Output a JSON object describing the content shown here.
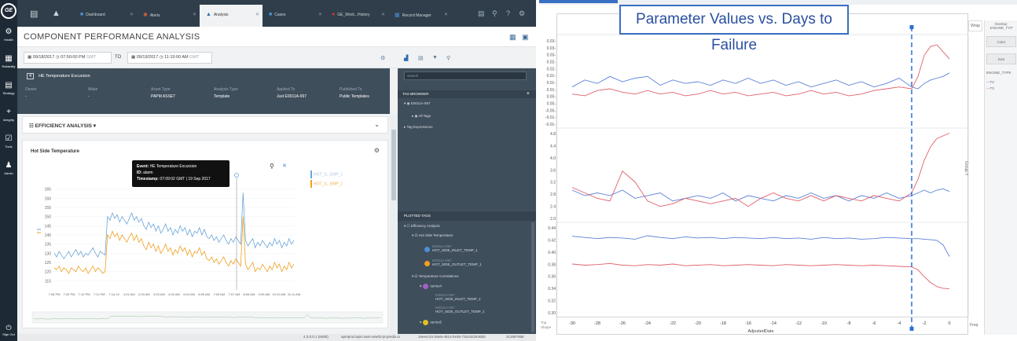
{
  "left_nav": {
    "logo": "GE",
    "items": [
      {
        "icon": "gear-icon",
        "glyph": "⚙",
        "label": "Health"
      },
      {
        "icon": "grid-icon",
        "glyph": "▦",
        "label": "Reliability"
      },
      {
        "icon": "calculator-icon",
        "glyph": "▤",
        "label": "Strategy"
      },
      {
        "icon": "plus-icon",
        "glyph": "+",
        "label": "Integrity"
      },
      {
        "icon": "check-icon",
        "glyph": "☑",
        "label": "Tools"
      },
      {
        "icon": "user-icon",
        "glyph": "♟",
        "label": "Admin"
      }
    ],
    "signout": "Sign Out"
  },
  "tabs": [
    {
      "label": "Dashboard",
      "icon": "dashboard-icon",
      "color": "#4a90d9"
    },
    {
      "label": "Alerts",
      "icon": "alert-icon",
      "color": "#e06040"
    },
    {
      "label": "Analysis",
      "icon": "analysis-icon",
      "color": "#2b6cb0"
    },
    {
      "label": "Cases",
      "icon": "cases-icon",
      "color": "#4a90d9"
    },
    {
      "label": "GE_Work...History",
      "icon": "history-icon",
      "color": "#d9342b"
    },
    {
      "label": "Record Manager",
      "icon": "record-icon",
      "color": "#4a90d9"
    }
  ],
  "page": {
    "title": "COMPONENT PERFORMANCE ANALYSIS"
  },
  "dates": {
    "from_date": "09/18/2017",
    "from_time": "07:50:00 PM",
    "to_label": "TO",
    "to_date": "09/19/2017",
    "to_time": "11:19:00 AM",
    "tz": "GMT"
  },
  "asset": {
    "num": "4",
    "name": "HE Temperature Excursion",
    "owner_h": "Owner",
    "owner_v": "-",
    "make_h": "Make",
    "make_v": "-",
    "type_h": "Asset Type",
    "type_v": "PAPM ASSET",
    "atype_h": "Analysis Type",
    "atype_v": "Template",
    "applied_h": "Applied To",
    "applied_v": "Just E0011A-097",
    "pub_h": "Published To",
    "pub_v": "Public Templates"
  },
  "eff": {
    "title": "EFFICIENCY ANALYSIS"
  },
  "chart_card": {
    "title": "Hot Side Temperature"
  },
  "tooltip": {
    "event_k": "Event:",
    "event_v": "HE Temperature Excursion",
    "id_k": "ID:",
    "id_v": "alarm",
    "ts_k": "Timestamp:",
    "ts_v": "07:09:02 GMT | 19 Sep 2017"
  },
  "legend": [
    {
      "label": "HOT_S...EMP_1",
      "color": "#6aa5d9"
    },
    {
      "label": "HOT_S...EMP_1",
      "color": "#f0a020"
    }
  ],
  "right_panel": {
    "search": "Search",
    "tag_browser": "TAG BROWSER",
    "tag_root": "E0011A-097",
    "all_tags": "All Tags",
    "tag_expr": "Tag Expressions",
    "plotted": "PLOTTED TAGS",
    "p_eff": "Efficiency Analysis",
    "p_hot": "Hot Side Temperature",
    "p_t1_a": "E0011A-097",
    "p_t1_b": "HOT_SIDE_INLET_TEMP_1",
    "p_t2_a": "E0011A-097",
    "p_t2_b": "HOT_SIDE_OUTLET_TEMP_1",
    "p_corr": "Temperature Correlations",
    "p_series4": "series4",
    "p_t3_a": "E0011A-097",
    "p_t3_b": "HOT_SIDE_INLET_TEMP_1",
    "p_t4_a": "E0011A-097",
    "p_t4_b": "HOT_SIDE_OUTLET_TEMP_1",
    "p_series5": "series5"
  },
  "status": {
    "version": "4.3.0.0.1 (8480)",
    "host": "apmprod.apm.aws-usw02-pr.predix.io",
    "id": "1eeecc51-b6a5-4813-be35-73a1922646b0",
    "num": "212587958"
  },
  "chart_data": [
    {
      "type": "line",
      "title": "Hot Side Temperature",
      "ylim": [
        110,
        170
      ],
      "y_ticks": [
        "165",
        "160",
        "155",
        "150",
        "145",
        "140",
        "135",
        "130",
        "125",
        "120",
        "115"
      ],
      "x_ticks": [
        "7:08 PM",
        "7:09 PM",
        "7:10 PM",
        "7:11 PM",
        "7:1a 10",
        "1:01 AM",
        "2:03 AM",
        "3:03 AM",
        "4:04 AM",
        "5:04 AM",
        "6:06 AM",
        "7:06 AM",
        "7:07 AM",
        "8:08 AM",
        "9:09 AM",
        "10:10 AM",
        "11:11 AM"
      ],
      "series": [
        {
          "name": "HOT_S...EMP_1",
          "color": "#6aa5d9",
          "values": [
            130,
            128,
            131,
            129,
            127,
            129,
            131,
            128,
            130,
            132,
            129,
            131,
            128,
            130,
            129,
            131,
            133,
            130,
            128,
            131,
            130,
            129,
            150,
            148,
            152,
            149,
            151,
            147,
            150,
            148,
            146,
            149,
            152,
            148,
            150,
            147,
            149,
            145,
            143,
            147,
            144,
            146,
            142,
            145,
            141,
            143,
            146,
            142,
            144,
            140,
            143,
            141,
            145,
            142,
            144,
            140,
            143,
            139,
            142,
            141,
            144,
            140,
            143,
            139,
            138,
            140,
            137,
            139,
            136,
            138,
            140,
            137,
            135,
            138,
            136,
            139,
            137,
            135,
            163,
            137,
            134,
            136,
            138,
            133,
            136,
            134,
            137,
            135,
            133,
            136,
            134,
            138,
            135,
            137,
            133,
            136,
            134,
            138,
            135,
            137
          ]
        },
        {
          "name": "HOT_S...EMP_1",
          "color": "#f0a020",
          "values": [
            122,
            121,
            123,
            120,
            122,
            121,
            119,
            122,
            121,
            120,
            123,
            121,
            120,
            122,
            119,
            121,
            123,
            120,
            122,
            121,
            119,
            120,
            140,
            138,
            142,
            139,
            141,
            137,
            140,
            138,
            136,
            139,
            141,
            137,
            140,
            136,
            138,
            134,
            132,
            136,
            133,
            135,
            131,
            134,
            130,
            132,
            135,
            131,
            133,
            129,
            132,
            130,
            134,
            131,
            133,
            129,
            132,
            128,
            131,
            130,
            133,
            129,
            131,
            127,
            126,
            128,
            125,
            127,
            124,
            126,
            128,
            125,
            123,
            126,
            124,
            127,
            125,
            123,
            150,
            124,
            121,
            123,
            125,
            120,
            122,
            121,
            124,
            122,
            120,
            123,
            121,
            125,
            122,
            124,
            120,
            123,
            121,
            125,
            122,
            124
          ]
        }
      ]
    },
    {
      "type": "line",
      "title": "Parameter Values vs. Days to Failure",
      "xlabel": "AdjustedDate",
      "x_ticks": [
        -30,
        -28,
        -26,
        -24,
        -22,
        -20,
        -18,
        -16,
        -14,
        -12,
        -10,
        -8,
        -6,
        -4,
        -2,
        0
      ],
      "xlim": [
        -31,
        1
      ],
      "marker_x": -3,
      "legend_title": "ENGINE_TYPE",
      "legend": [
        {
          "name": "T2",
          "color": "#5b82d8"
        },
        {
          "name": "T3",
          "color": "#e0606a"
        }
      ],
      "side_labels": {
        "overlay": "Overlay:",
        "overlay_v": "ENGINE_TYP",
        "color": "Color",
        "size": "Size",
        "wrap": "Wrap",
        "groupy": "Group Y",
        "freq": "Freq",
        "topshape": "Top\nShape"
      },
      "panels": [
        {
          "ylim": [
            -0.012,
            0.038
          ],
          "y_ticks": [
            "0.03-",
            "0.03-",
            "0.03-",
            "0.02-",
            "0.02-",
            "0.01-",
            "0.01-",
            "0.01-",
            "0.00-",
            "0.00-",
            "-0.00-",
            "-0.01-",
            "-0.01-"
          ],
          "x": [
            -30,
            -29,
            -28,
            -27,
            -26,
            -25,
            -24,
            -23,
            -22,
            -21,
            -20,
            -19,
            -18,
            -17,
            -16,
            -15,
            -14,
            -13,
            -12,
            -11,
            -10,
            -9,
            -8,
            -7,
            -6,
            -5,
            -4,
            -3,
            -2.5,
            -2,
            -1.5,
            -1,
            -0.5,
            0
          ],
          "series": [
            {
              "name": "T2",
              "values": [
                0.01,
                0.014,
                0.012,
                0.016,
                0.013,
                0.015,
                0.016,
                0.011,
                0.014,
                0.012,
                0.013,
                0.011,
                0.014,
                0.012,
                0.015,
                0.012,
                0.014,
                0.011,
                0.013,
                0.01,
                0.012,
                0.014,
                0.011,
                0.013,
                0.01,
                0.012,
                0.015,
                0.01,
                0.009,
                0.012,
                0.014,
                0.015,
                0.016,
                0.018
              ]
            },
            {
              "name": "T3",
              "values": [
                0.006,
                0.005,
                0.008,
                0.009,
                0.007,
                0.006,
                0.008,
                0.006,
                0.007,
                0.005,
                0.006,
                0.008,
                0.006,
                0.007,
                0.005,
                0.006,
                0.007,
                0.005,
                0.006,
                0.008,
                0.006,
                0.007,
                0.005,
                0.006,
                0.008,
                0.009,
                0.01,
                0.009,
                0.016,
                0.028,
                0.033,
                0.034,
                0.03,
                0.026
              ]
            }
          ]
        },
        {
          "ylim": [
            1.8,
            5.1
          ],
          "y_ticks": [
            "4.8",
            "4.4",
            "4.0",
            "3.6",
            "3.2",
            "2.8",
            "2.4",
            "2.0"
          ],
          "x": [
            -30,
            -29,
            -28,
            -27,
            -26,
            -25,
            -24,
            -23,
            -22,
            -21,
            -20,
            -19,
            -18,
            -17,
            -16,
            -15,
            -14,
            -13,
            -12,
            -11,
            -10,
            -9,
            -8,
            -7,
            -6,
            -5,
            -4,
            -3,
            -2.5,
            -2,
            -1.5,
            -1,
            -0.5,
            0
          ],
          "series": [
            {
              "name": "T2",
              "values": [
                2.9,
                2.7,
                2.8,
                2.7,
                2.9,
                2.6,
                2.7,
                2.8,
                2.5,
                2.6,
                2.7,
                2.6,
                2.8,
                2.5,
                2.7,
                2.6,
                2.5,
                2.7,
                2.6,
                2.8,
                2.6,
                2.7,
                2.5,
                2.7,
                2.6,
                2.8,
                2.6,
                2.7,
                2.8,
                2.9,
                2.8,
                2.9,
                2.95,
                2.85
              ]
            },
            {
              "name": "T3",
              "values": [
                3.0,
                2.8,
                2.6,
                2.5,
                3.6,
                3.2,
                2.5,
                2.3,
                2.4,
                2.6,
                2.5,
                2.4,
                2.5,
                2.6,
                2.3,
                2.6,
                2.8,
                2.6,
                2.5,
                2.7,
                2.5,
                2.7,
                2.6,
                2.5,
                2.7,
                2.6,
                2.5,
                2.8,
                3.3,
                4.0,
                4.5,
                4.8,
                4.9,
                5.0
              ]
            }
          ]
        },
        {
          "ylim": [
            0.295,
            0.45
          ],
          "y_ticks": [
            "0.44",
            "0.42",
            "0.40",
            "0.38",
            "0.36",
            "0.34",
            "0.32",
            "0.30"
          ],
          "x": [
            -30,
            -29,
            -28,
            -27,
            -26,
            -25,
            -24,
            -23,
            -22,
            -21,
            -20,
            -19,
            -18,
            -17,
            -16,
            -15,
            -14,
            -13,
            -12,
            -11,
            -10,
            -9,
            -8,
            -7,
            -6,
            -5,
            -4,
            -3,
            -2.5,
            -2,
            -1.5,
            -1,
            -0.5,
            0
          ],
          "series": [
            {
              "name": "T2",
              "values": [
                0.43,
                0.428,
                0.426,
                0.428,
                0.427,
                0.425,
                0.431,
                0.428,
                0.426,
                0.429,
                0.427,
                0.428,
                0.426,
                0.428,
                0.427,
                0.426,
                0.428,
                0.426,
                0.427,
                0.425,
                0.428,
                0.426,
                0.427,
                0.425,
                0.426,
                0.428,
                0.427,
                0.426,
                0.426,
                0.425,
                0.424,
                0.423,
                0.415,
                0.395
              ]
            },
            {
              "name": "T3",
              "values": [
                0.382,
                0.38,
                0.381,
                0.383,
                0.38,
                0.379,
                0.381,
                0.38,
                0.382,
                0.379,
                0.38,
                0.381,
                0.379,
                0.38,
                0.381,
                0.38,
                0.379,
                0.381,
                0.38,
                0.379,
                0.38,
                0.381,
                0.38,
                0.379,
                0.38,
                0.379,
                0.378,
                0.377,
                0.372,
                0.36,
                0.35,
                0.343,
                0.34,
                0.339
              ]
            }
          ]
        }
      ]
    }
  ]
}
